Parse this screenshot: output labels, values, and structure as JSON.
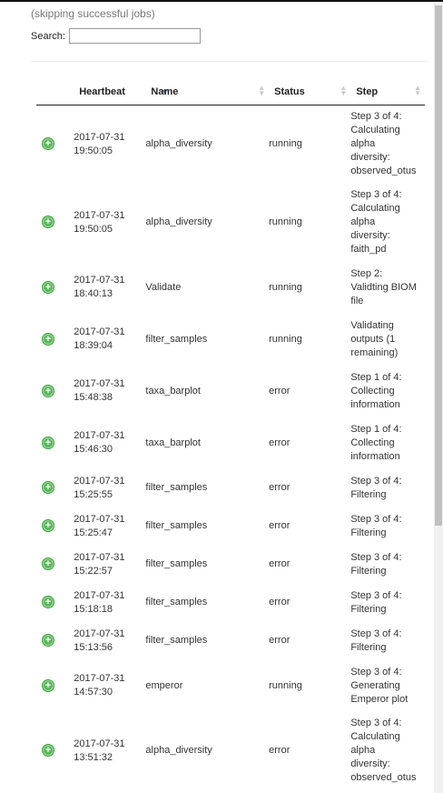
{
  "header_note": "(skipping successful jobs)",
  "search": {
    "label": "Search:",
    "value": ""
  },
  "columns": [
    {
      "key": "heartbeat",
      "label": "Heartbeat",
      "sorted": true
    },
    {
      "key": "name",
      "label": "Name",
      "sorted": false
    },
    {
      "key": "status",
      "label": "Status",
      "sorted": false
    },
    {
      "key": "step",
      "label": "Step",
      "sorted": false
    }
  ],
  "rows": [
    {
      "date": "2017-07-31",
      "time": "19:50:05",
      "name": "alpha_diversity",
      "status": "running",
      "step": [
        "Step 3 of 4:",
        "Calculating",
        "alpha",
        "diversity:",
        "observed_otus"
      ],
      "h": 86
    },
    {
      "date": "2017-07-31",
      "time": "19:50:05",
      "name": "alpha_diversity",
      "status": "running",
      "step": [
        "Step 3 of 4:",
        "Calculating",
        "alpha",
        "diversity:",
        "faith_pd"
      ],
      "h": 86
    },
    {
      "date": "2017-07-31",
      "time": "18:40:13",
      "name": "Validate",
      "status": "running",
      "step": [
        "Step 2:",
        "Validting BIOM",
        "file"
      ],
      "h": 57
    },
    {
      "date": "2017-07-31",
      "time": "18:39:04",
      "name": "filter_samples",
      "status": "running",
      "step": [
        "Validating",
        "outputs (1",
        "remaining)"
      ],
      "h": 57
    },
    {
      "date": "2017-07-31",
      "time": "15:48:38",
      "name": "taxa_barplot",
      "status": "error",
      "step": [
        "Step 1 of 4:",
        "Collecting",
        "information"
      ],
      "h": 57
    },
    {
      "date": "2017-07-31",
      "time": "15:46:30",
      "name": "taxa_barplot",
      "status": "error",
      "step": [
        "Step 1 of 4:",
        "Collecting",
        "information"
      ],
      "h": 57
    },
    {
      "date": "2017-07-31",
      "time": "15:25:55",
      "name": "filter_samples",
      "status": "error",
      "step": [
        "Step 3 of 4:",
        "Filtering"
      ],
      "h": 42
    },
    {
      "date": "2017-07-31",
      "time": "15:25:47",
      "name": "filter_samples",
      "status": "error",
      "step": [
        "Step 3 of 4:",
        "Filtering"
      ],
      "h": 42
    },
    {
      "date": "2017-07-31",
      "time": "15:22:57",
      "name": "filter_samples",
      "status": "error",
      "step": [
        "Step 3 of 4:",
        "Filtering"
      ],
      "h": 42
    },
    {
      "date": "2017-07-31",
      "time": "15:18:18",
      "name": "filter_samples",
      "status": "error",
      "step": [
        "Step 3 of 4:",
        "Filtering"
      ],
      "h": 42
    },
    {
      "date": "2017-07-31",
      "time": "15:13:56",
      "name": "filter_samples",
      "status": "error",
      "step": [
        "Step 3 of 4:",
        "Filtering"
      ],
      "h": 42
    },
    {
      "date": "2017-07-31",
      "time": "14:57:30",
      "name": "emperor",
      "status": "running",
      "step": [
        "Step 3 of 4:",
        "Generating",
        "Emperor plot"
      ],
      "h": 57
    },
    {
      "date": "2017-07-31",
      "time": "13:51:32",
      "name": "alpha_diversity",
      "status": "error",
      "step": [
        "Step 3 of 4:",
        "Calculating",
        "alpha",
        "diversity:",
        "observed_otus"
      ],
      "h": 86
    }
  ],
  "icons": {
    "expand": "plus-circle-icon",
    "sort_desc": "sort-desc-icon",
    "sort_both": "sort-both-icon"
  },
  "colors": {
    "expand_icon": "#5cb85c",
    "sort_active": "#5b7fd3"
  }
}
